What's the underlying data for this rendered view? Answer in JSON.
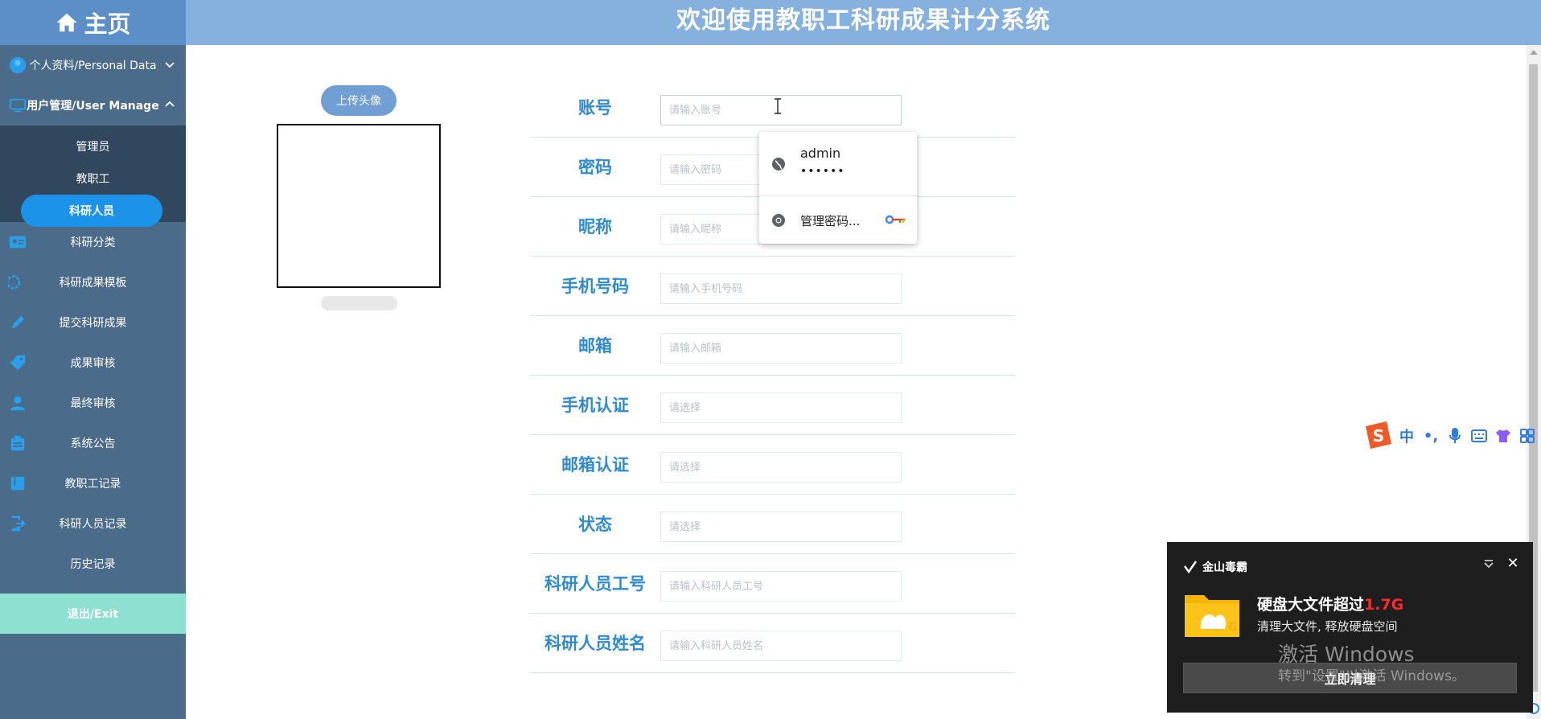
{
  "header": {
    "home_label": "主页",
    "title": "欢迎使用教职工科研成果计分系统"
  },
  "sidebar": {
    "items": [
      {
        "label": "个人资料/Personal Data",
        "icon": "user-circle-icon",
        "expanded": false
      },
      {
        "label": "用户管理/User Manage",
        "icon": "monitor-icon",
        "expanded": true
      },
      {
        "label": "科研分类",
        "icon": "id-card-icon"
      },
      {
        "label": "科研成果模板",
        "icon": "gear-icon"
      },
      {
        "label": "提交科研成果",
        "icon": "pencil-icon"
      },
      {
        "label": "成果审核",
        "icon": "tag-icon"
      },
      {
        "label": "最终审核",
        "icon": "user-group-icon"
      },
      {
        "label": "系统公告",
        "icon": "clipboard-icon"
      },
      {
        "label": "教职工记录",
        "icon": "book-icon"
      },
      {
        "label": "科研人员记录",
        "icon": "exit-door-icon"
      },
      {
        "label": "历史记录",
        "icon": ""
      }
    ],
    "sub_items": [
      {
        "label": "管理员",
        "active": false
      },
      {
        "label": "教职工",
        "active": false
      },
      {
        "label": "科研人员",
        "active": true
      }
    ],
    "exit_label": "退出/Exit"
  },
  "avatar": {
    "upload_label": "上传头像"
  },
  "form": {
    "fields": [
      {
        "label": "账号",
        "placeholder": "请输入账号",
        "value": ""
      },
      {
        "label": "密码",
        "placeholder": "请输入密码",
        "value": ""
      },
      {
        "label": "昵称",
        "placeholder": "请输入昵称",
        "value": ""
      },
      {
        "label": "手机号码",
        "placeholder": "请输入手机号码",
        "value": ""
      },
      {
        "label": "邮箱",
        "placeholder": "请输入邮箱",
        "value": ""
      },
      {
        "label": "手机认证",
        "placeholder": "请选择",
        "value": ""
      },
      {
        "label": "邮箱认证",
        "placeholder": "请选择",
        "value": ""
      },
      {
        "label": "状态",
        "placeholder": "请选择",
        "value": ""
      },
      {
        "label": "科研人员工号",
        "placeholder": "请输入科研人员工号",
        "value": ""
      },
      {
        "label": "科研人员姓名",
        "placeholder": "请输入科研人员姓名",
        "value": ""
      }
    ]
  },
  "autofill": {
    "username": "admin",
    "password_mask": "••••••",
    "manage_label": "管理密码..."
  },
  "ime": {
    "mode_label": "中",
    "punct_label": "•,"
  },
  "notice": {
    "app_name": "金山毒霸",
    "headline": "硬盘大文件超过",
    "size": "1.7G",
    "subtitle": "清理大文件, 释放硬盘空间",
    "button": "立即清理"
  },
  "watermark": {
    "line1": "激活 Windows",
    "line2": "转到\"设置\"以激活 Windows。"
  },
  "colors": {
    "topbar": "#86b0dd",
    "sidebar": "#4b6b8a",
    "active_pill": "#1a93e8",
    "exit": "#8ee0d0",
    "label_blue": "#2f8bd0",
    "alert_red": "#ff2b2b"
  }
}
